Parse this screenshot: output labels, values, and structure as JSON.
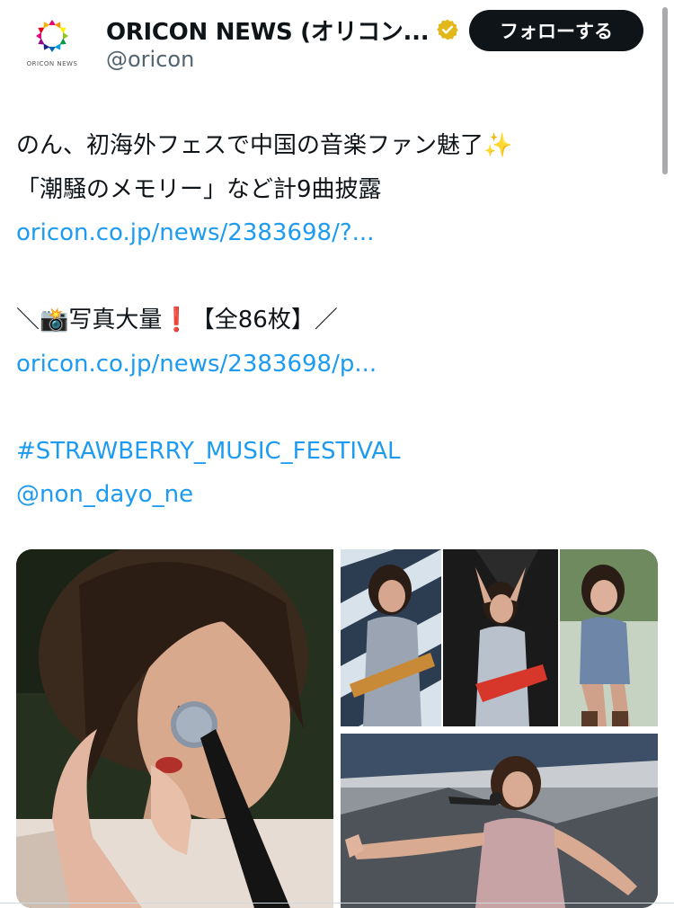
{
  "account": {
    "display_name": "ORICON NEWS (オリコン...",
    "handle": "@oricon",
    "avatar_label": "ORICON NEWS",
    "follow_label": "フォローする"
  },
  "tweet": {
    "line1": "のん、初海外フェスで中国の音楽ファン魅了✨",
    "line2": "「潮騒のメモリー」など計9曲披露",
    "link1": "oricon.co.jp/news/2383698/?...",
    "line3": "＼📸写真大量❗️【全86枚】／",
    "link2": "oricon.co.jp/news/2383698/p...",
    "hashtag": "#STRAWBERRY_MUSIC_FESTIVAL",
    "mention": "@non_dayo_ne"
  },
  "colors": {
    "link": "#1d9bf0",
    "text": "#0f1419",
    "secondary": "#536471",
    "verified": "#e2b719"
  },
  "icons": {
    "verified": "verified-badge-icon",
    "logo": "oricon-logo-icon"
  }
}
